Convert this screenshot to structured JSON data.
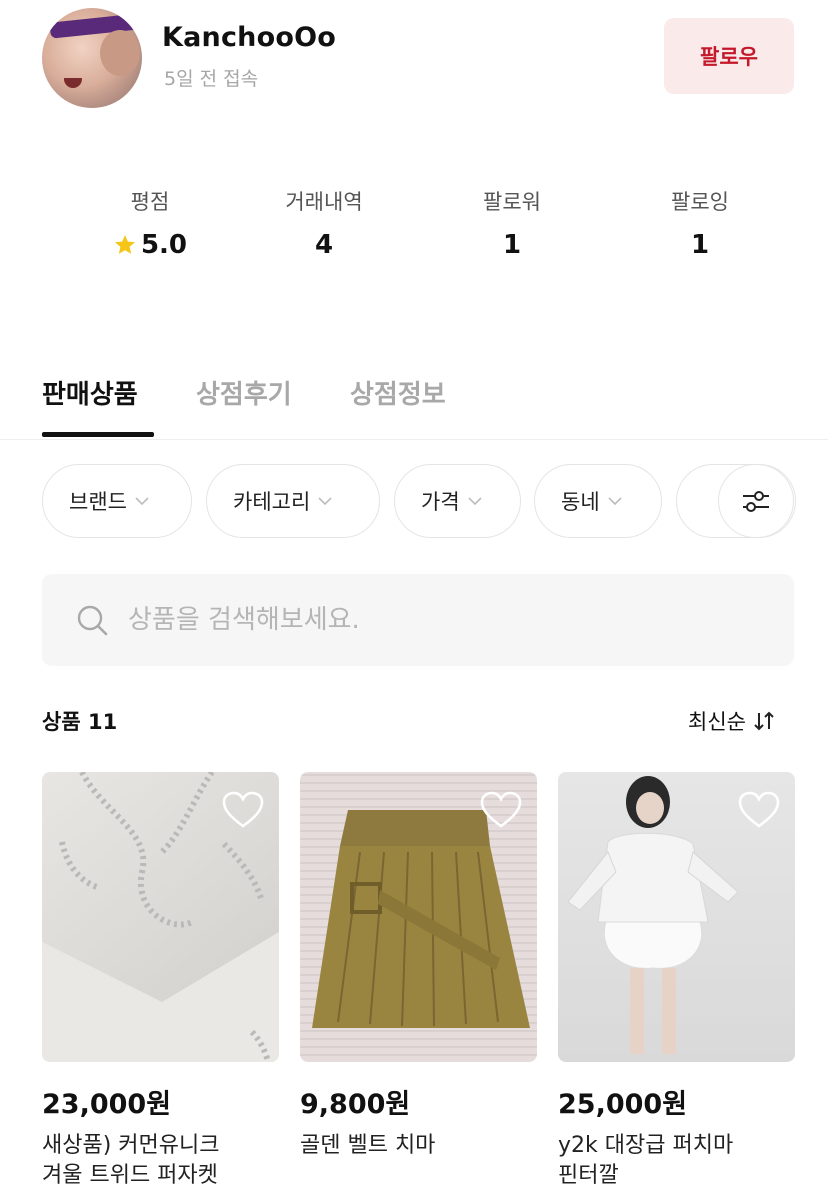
{
  "profile": {
    "username": "KanchooOo",
    "last_seen": "5일 전 접속",
    "follow_label": "팔로우"
  },
  "stats": [
    {
      "label": "평점",
      "value": "5.0"
    },
    {
      "label": "거래내역",
      "value": "4"
    },
    {
      "label": "팔로워",
      "value": "1"
    },
    {
      "label": "팔로잉",
      "value": "1"
    }
  ],
  "tabs": [
    {
      "label": "판매상품",
      "active": true
    },
    {
      "label": "상점후기",
      "active": false
    },
    {
      "label": "상점정보",
      "active": false
    }
  ],
  "filters": [
    {
      "label": "브랜드"
    },
    {
      "label": "카테고리"
    },
    {
      "label": "가격"
    },
    {
      "label": "동네"
    }
  ],
  "search": {
    "placeholder": "상품을 검색해보세요."
  },
  "products_header": {
    "count_label": "상품 11",
    "sort_label": "최신순"
  },
  "products": [
    {
      "price": "23,000원",
      "title_line1": "새상품) 커먼유니크",
      "title_line2": "겨울 트위드 퍼자켓"
    },
    {
      "price": "9,800원",
      "title_line1": "골덴 벨트 치마",
      "title_line2": ""
    },
    {
      "price": "25,000원",
      "title_line1": "y2k 대장급 퍼치마",
      "title_line2": "핀터깔"
    }
  ],
  "colors": {
    "accent": "#c4192b",
    "follow_bg": "#fbeaea",
    "star": "#f5c518",
    "muted_text": "#a6a6a6"
  },
  "icons": {
    "rating": "star-icon",
    "filter_chevron": "chevron-down-icon",
    "filter_settings": "sliders-icon",
    "search": "search-icon",
    "sort": "sort-arrows-icon",
    "like": "heart-icon"
  }
}
